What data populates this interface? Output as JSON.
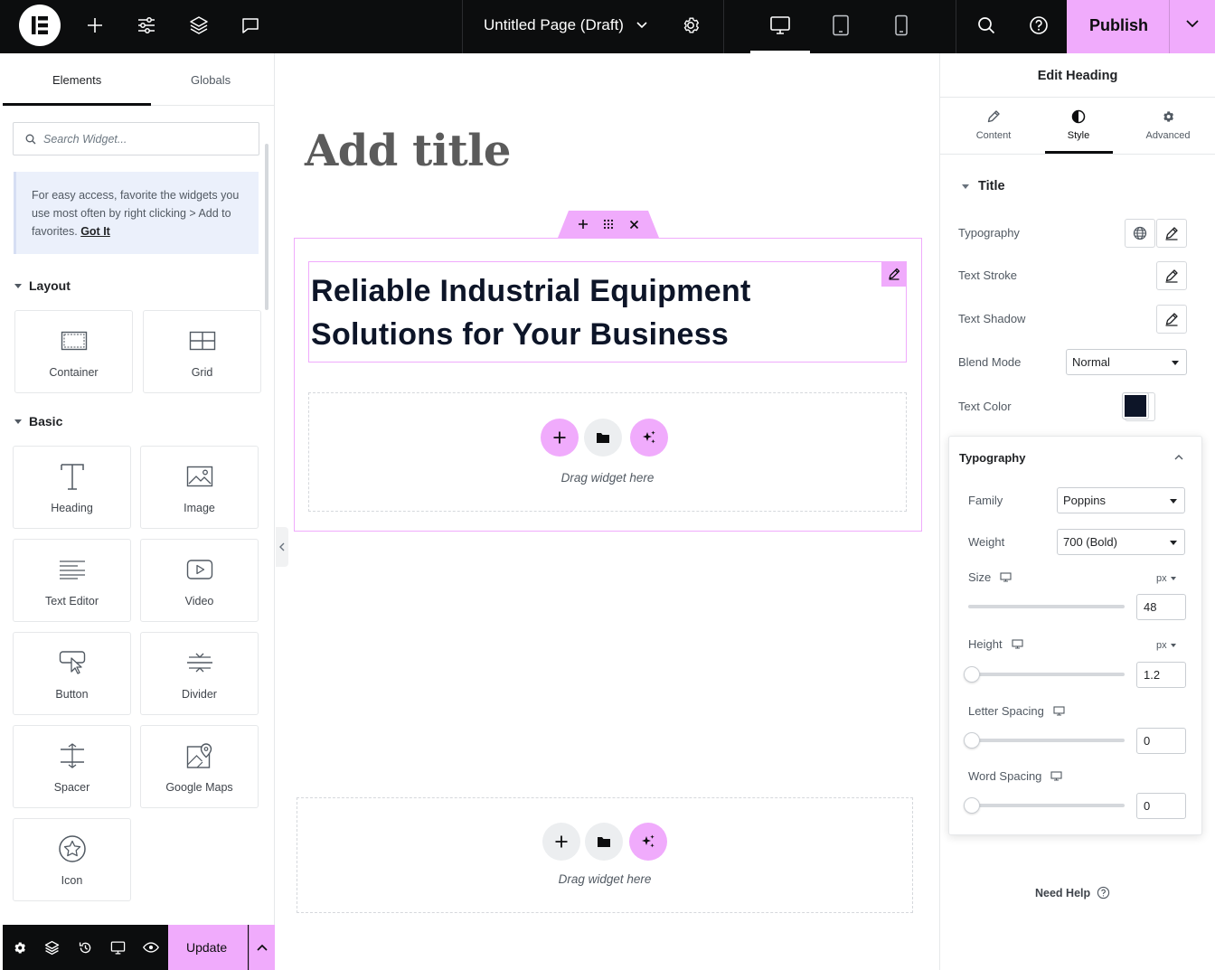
{
  "topbar": {
    "page_title": "Untitled Page (Draft)",
    "publish_label": "Publish",
    "icons": [
      "elementor-logo",
      "plus-icon",
      "sliders-icon",
      "layers-icon",
      "comment-icon",
      "chevron-down-icon",
      "gear-icon",
      "desktop-icon",
      "tablet-icon",
      "mobile-icon",
      "search-icon",
      "help-icon"
    ]
  },
  "left_panel": {
    "tabs": [
      "Elements",
      "Globals"
    ],
    "search_placeholder": "Search Widget...",
    "tip_text": "For easy access, favorite the widgets you use most often by right clicking > Add to favorites.",
    "tip_link": "Got It",
    "categories": {
      "layout": "Layout",
      "basic": "Basic"
    },
    "layout_widgets": [
      "Container",
      "Grid"
    ],
    "basic_widgets": [
      "Heading",
      "Image",
      "Text Editor",
      "Video",
      "Button",
      "Divider",
      "Spacer",
      "Google Maps",
      "Icon"
    ],
    "footer_update_label": "Update"
  },
  "canvas": {
    "page_title": "Add title",
    "heading_text": "Reliable Industrial Equipment Solutions for Your Business",
    "drop_text": "Drag widget here",
    "drop_text_2": "Drag widget here"
  },
  "right_panel": {
    "title": "Edit Heading",
    "tabs": [
      "Content",
      "Style",
      "Advanced"
    ],
    "active_tab": "Style",
    "section_title": "Title",
    "controls": {
      "typography": "Typography",
      "text_stroke": "Text Stroke",
      "text_shadow": "Text Shadow",
      "blend_mode": "Blend Mode",
      "blend_mode_value": "Normal",
      "text_color": "Text Color",
      "text_color_value": "#0d1528"
    },
    "typography_popover": {
      "title": "Typography",
      "family_label": "Family",
      "family_value": "Poppins",
      "weight_label": "Weight",
      "weight_value": "700 (Bold)",
      "size_label": "Size",
      "size_unit": "px",
      "size_value": "48",
      "height_label": "Height",
      "height_unit": "px",
      "height_value": "1.2",
      "letter_spacing_label": "Letter Spacing",
      "letter_spacing_value": "0",
      "word_spacing_label": "Word Spacing",
      "word_spacing_value": "0"
    },
    "help_label": "Need Help"
  },
  "colors": {
    "accent": "#f0abfc",
    "topbar_bg": "#0c0d0e",
    "heading_color": "#0d1528"
  }
}
